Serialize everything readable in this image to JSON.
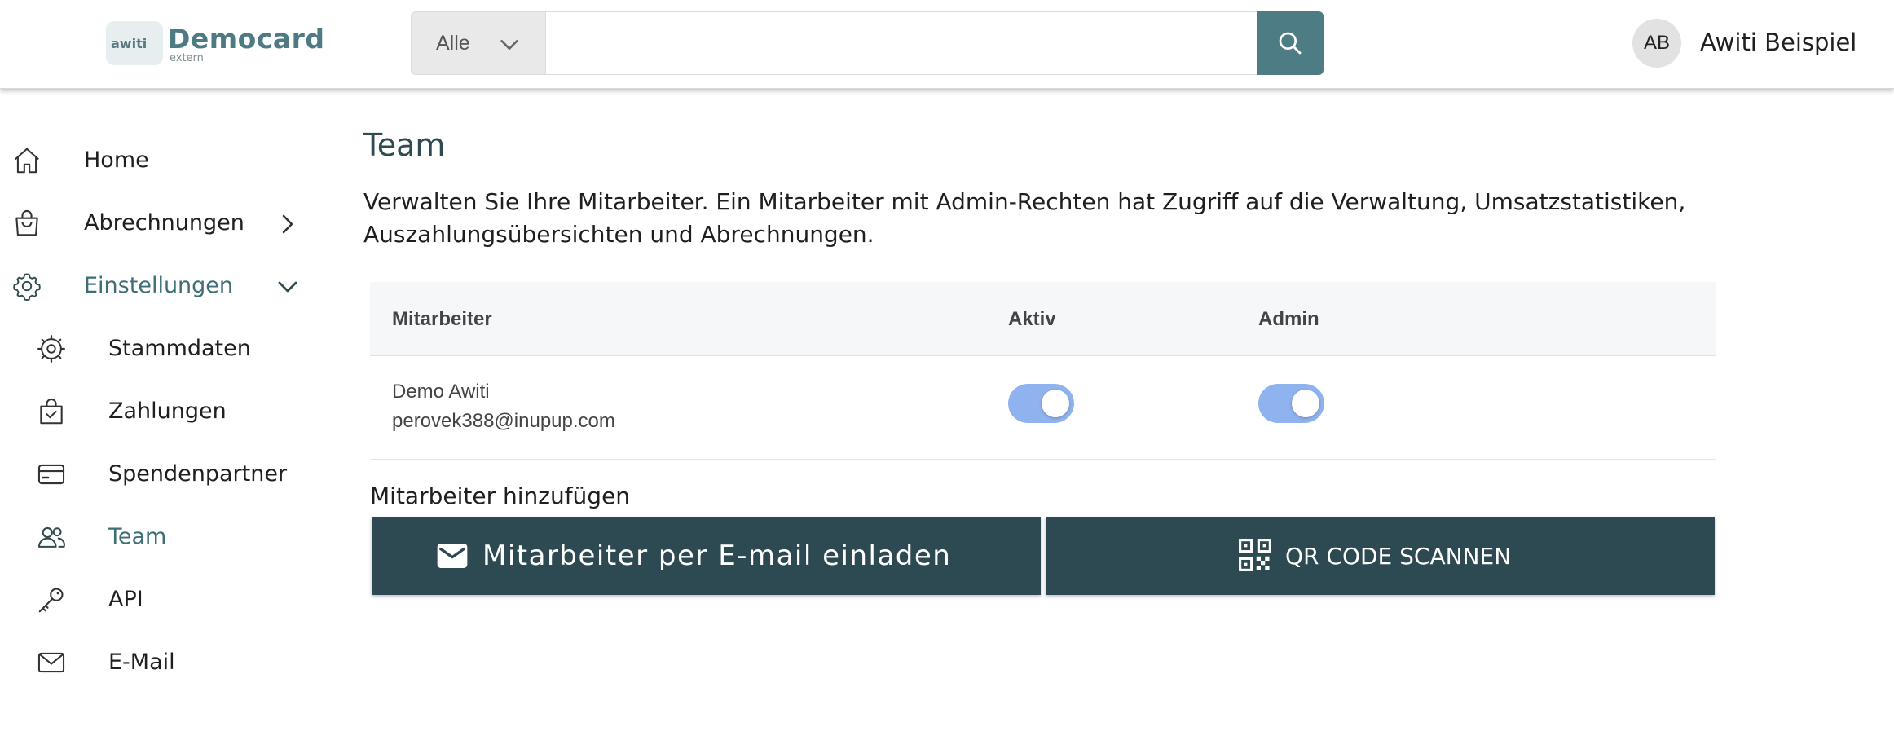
{
  "header": {
    "logo": {
      "badge_text": "awiti",
      "name": "Democard",
      "sub": "extern"
    },
    "search": {
      "scope_selected": "Alle",
      "query": "",
      "placeholder": ""
    },
    "user": {
      "initials": "AB",
      "name": "Awiti Beispiel"
    }
  },
  "sidebar": {
    "items": [
      {
        "label": "Home",
        "icon": "home-icon"
      },
      {
        "label": "Abrechnungen",
        "icon": "shopping-bag-icon"
      },
      {
        "label": "Einstellungen",
        "icon": "gear-icon"
      }
    ],
    "sub_items": [
      {
        "label": "Stammdaten",
        "icon": "cog-outline-icon"
      },
      {
        "label": "Zahlungen",
        "icon": "bag-check-icon"
      },
      {
        "label": "Spendenpartner",
        "icon": "credit-card-icon"
      },
      {
        "label": "Team",
        "icon": "people-icon"
      },
      {
        "label": "API",
        "icon": "key-icon"
      },
      {
        "label": "E-Mail",
        "icon": "envelope-icon"
      }
    ]
  },
  "main": {
    "title": "Team",
    "description": "Verwalten Sie Ihre Mitarbeiter. Ein Mitarbeiter mit Admin-Rechten hat Zugriff auf die Verwaltung, Umsatzstatistiken, Auszahlungsübersichten und Abrechnungen.",
    "table": {
      "headers": [
        "Mitarbeiter",
        "Aktiv",
        "Admin"
      ],
      "rows": [
        {
          "name": "Demo Awiti",
          "email": "perovek388@inupup.com",
          "active": true,
          "admin": true
        }
      ]
    },
    "add_heading": "Mitarbeiter hinzufügen",
    "invite_button": "Mitarbeiter per E-mail einladen",
    "qr_button": "QR CODE SCANNEN"
  },
  "colors": {
    "accent": "#4e7c84",
    "button_dark": "#2d4a52",
    "toggle_on": "#8fb3ee",
    "active_nav": "#3e6f77"
  }
}
